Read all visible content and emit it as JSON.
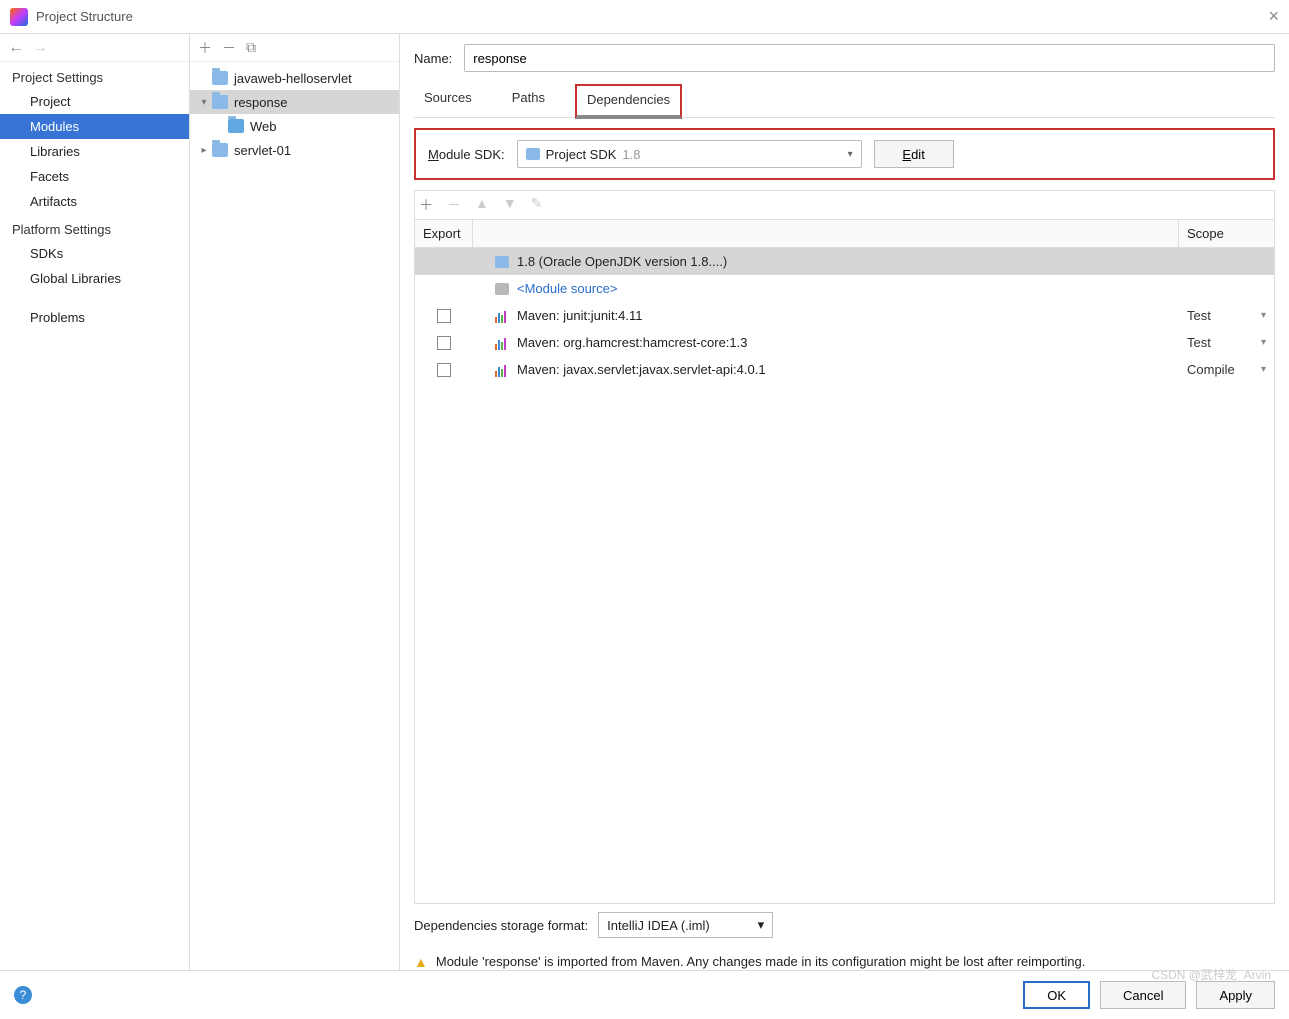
{
  "window": {
    "title": "Project Structure"
  },
  "sidebar": {
    "sections": [
      {
        "title": "Project Settings",
        "items": [
          "Project",
          "Modules",
          "Libraries",
          "Facets",
          "Artifacts"
        ],
        "selectedIndex": 1
      },
      {
        "title": "Platform Settings",
        "items": [
          "SDKs",
          "Global Libraries"
        ]
      },
      {
        "title": "",
        "items": [
          "Problems"
        ]
      }
    ]
  },
  "tree": {
    "nodes": [
      {
        "label": "javaweb-helloservlet",
        "indent": 0,
        "expander": ""
      },
      {
        "label": "response",
        "indent": 0,
        "expander": "▾",
        "selected": true
      },
      {
        "label": "Web",
        "indent": 1,
        "expander": ""
      },
      {
        "label": "servlet-01",
        "indent": 0,
        "expander": "▸"
      }
    ]
  },
  "content": {
    "nameLabel": "Name:",
    "nameValue": "response",
    "tabs": [
      "Sources",
      "Paths",
      "Dependencies"
    ],
    "activeTab": 2,
    "sdkLabel": "Module SDK:",
    "sdkValue": "Project SDK",
    "sdkVersion": "1.8",
    "editLabel": "Edit",
    "depHeader": {
      "export": "Export",
      "scope": "Scope"
    },
    "deps": [
      {
        "type": "sdk",
        "label": "1.8 (Oracle OpenJDK version 1.8....)",
        "selected": true
      },
      {
        "type": "module",
        "label": "<Module source>"
      },
      {
        "type": "maven",
        "label": "Maven: junit:junit:4.11",
        "export": false,
        "scope": "Test"
      },
      {
        "type": "maven",
        "label": "Maven: org.hamcrest:hamcrest-core:1.3",
        "export": false,
        "scope": "Test"
      },
      {
        "type": "maven",
        "label": "Maven: javax.servlet:javax.servlet-api:4.0.1",
        "export": false,
        "scope": "Compile"
      }
    ],
    "storageLabel": "Dependencies storage format:",
    "storageValue": "IntelliJ IDEA (.iml)",
    "warning": "Module 'response' is imported from Maven. Any changes made in its configuration might be lost after reimporting."
  },
  "footer": {
    "ok": "OK",
    "cancel": "Cancel",
    "apply": "Apply"
  },
  "watermark": "CSDN @武梓龙_Arvin"
}
